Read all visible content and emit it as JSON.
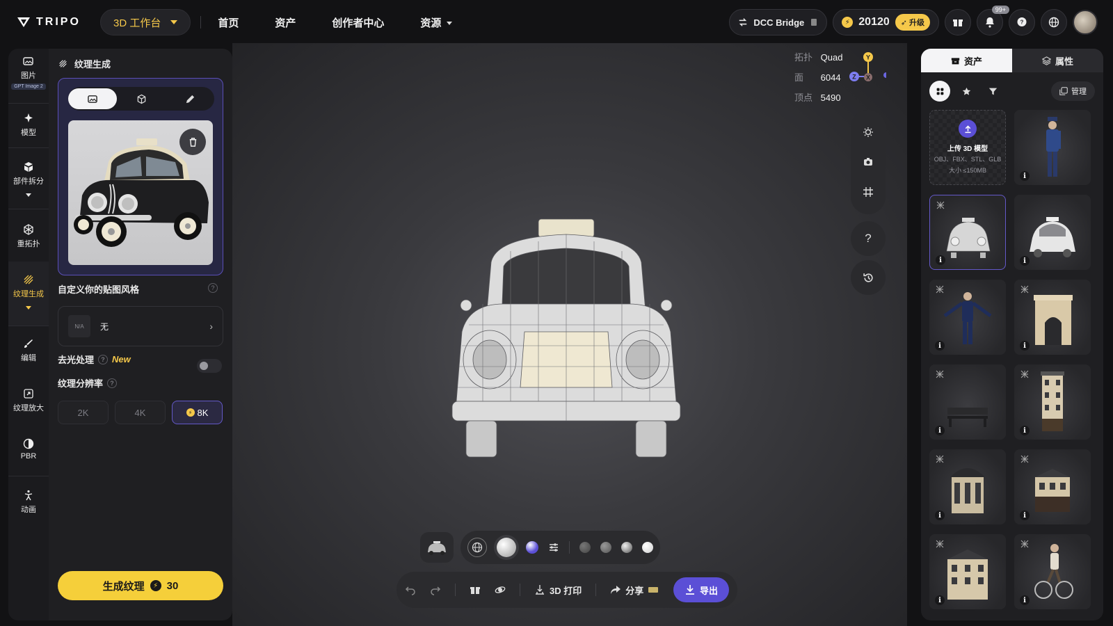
{
  "brand": {
    "name": "TRIPO"
  },
  "header": {
    "workspace": "3D 工作台",
    "nav": [
      "首页",
      "资产",
      "创作者中心",
      "资源"
    ],
    "dcc_bridge": "DCC Bridge",
    "credits": "20120",
    "upgrade": "升级",
    "notif_count": "99+"
  },
  "rail": {
    "items": [
      {
        "label": "图片",
        "tag": "GPT Image 2",
        "icon": "image-icon"
      },
      {
        "label": "模型",
        "icon": "sparkle-icon"
      },
      {
        "label": "部件拆分",
        "icon": "cubes-icon"
      },
      {
        "label": "重拓扑",
        "icon": "topology-icon"
      },
      {
        "label": "纹理生成",
        "icon": "texture-icon",
        "active": true
      },
      {
        "label": "编辑",
        "icon": "brush-icon"
      },
      {
        "label": "纹理放大",
        "icon": "upscale-icon"
      },
      {
        "label": "PBR",
        "icon": "pbr-icon"
      },
      {
        "label": "动画",
        "icon": "animation-icon"
      }
    ]
  },
  "panel": {
    "title": "纹理生成",
    "style_label": "自定义你的贴图风格",
    "style_value": "无",
    "style_placeholder": "N/A",
    "delight_label": "去光处理",
    "new_tag": "New",
    "resolution_label": "纹理分辨率",
    "resolutions": [
      "2K",
      "4K",
      "8K"
    ],
    "selected_resolution": "8K",
    "generate_label": "生成纹理",
    "generate_cost": "30"
  },
  "viewport": {
    "stats": [
      {
        "k": "拓扑",
        "v": "Quad"
      },
      {
        "k": "面",
        "v": "6044"
      },
      {
        "k": "顶点",
        "v": "5490"
      }
    ],
    "axes": {
      "y": "Y",
      "z": "Z",
      "x": "X"
    },
    "help": "?",
    "print_label": "3D 打印",
    "share_label": "分享",
    "export_label": "导出"
  },
  "assets": {
    "tab_assets": "资产",
    "tab_props": "属性",
    "manage": "管理",
    "upload_title": "上传 3D 模型",
    "upload_formats": "OBJ、FBX、STL、GLB",
    "upload_limit": "大小 ≤150MB"
  },
  "colors": {
    "accent": "#f5cf3a",
    "brand_purple": "#5b4fd6"
  }
}
